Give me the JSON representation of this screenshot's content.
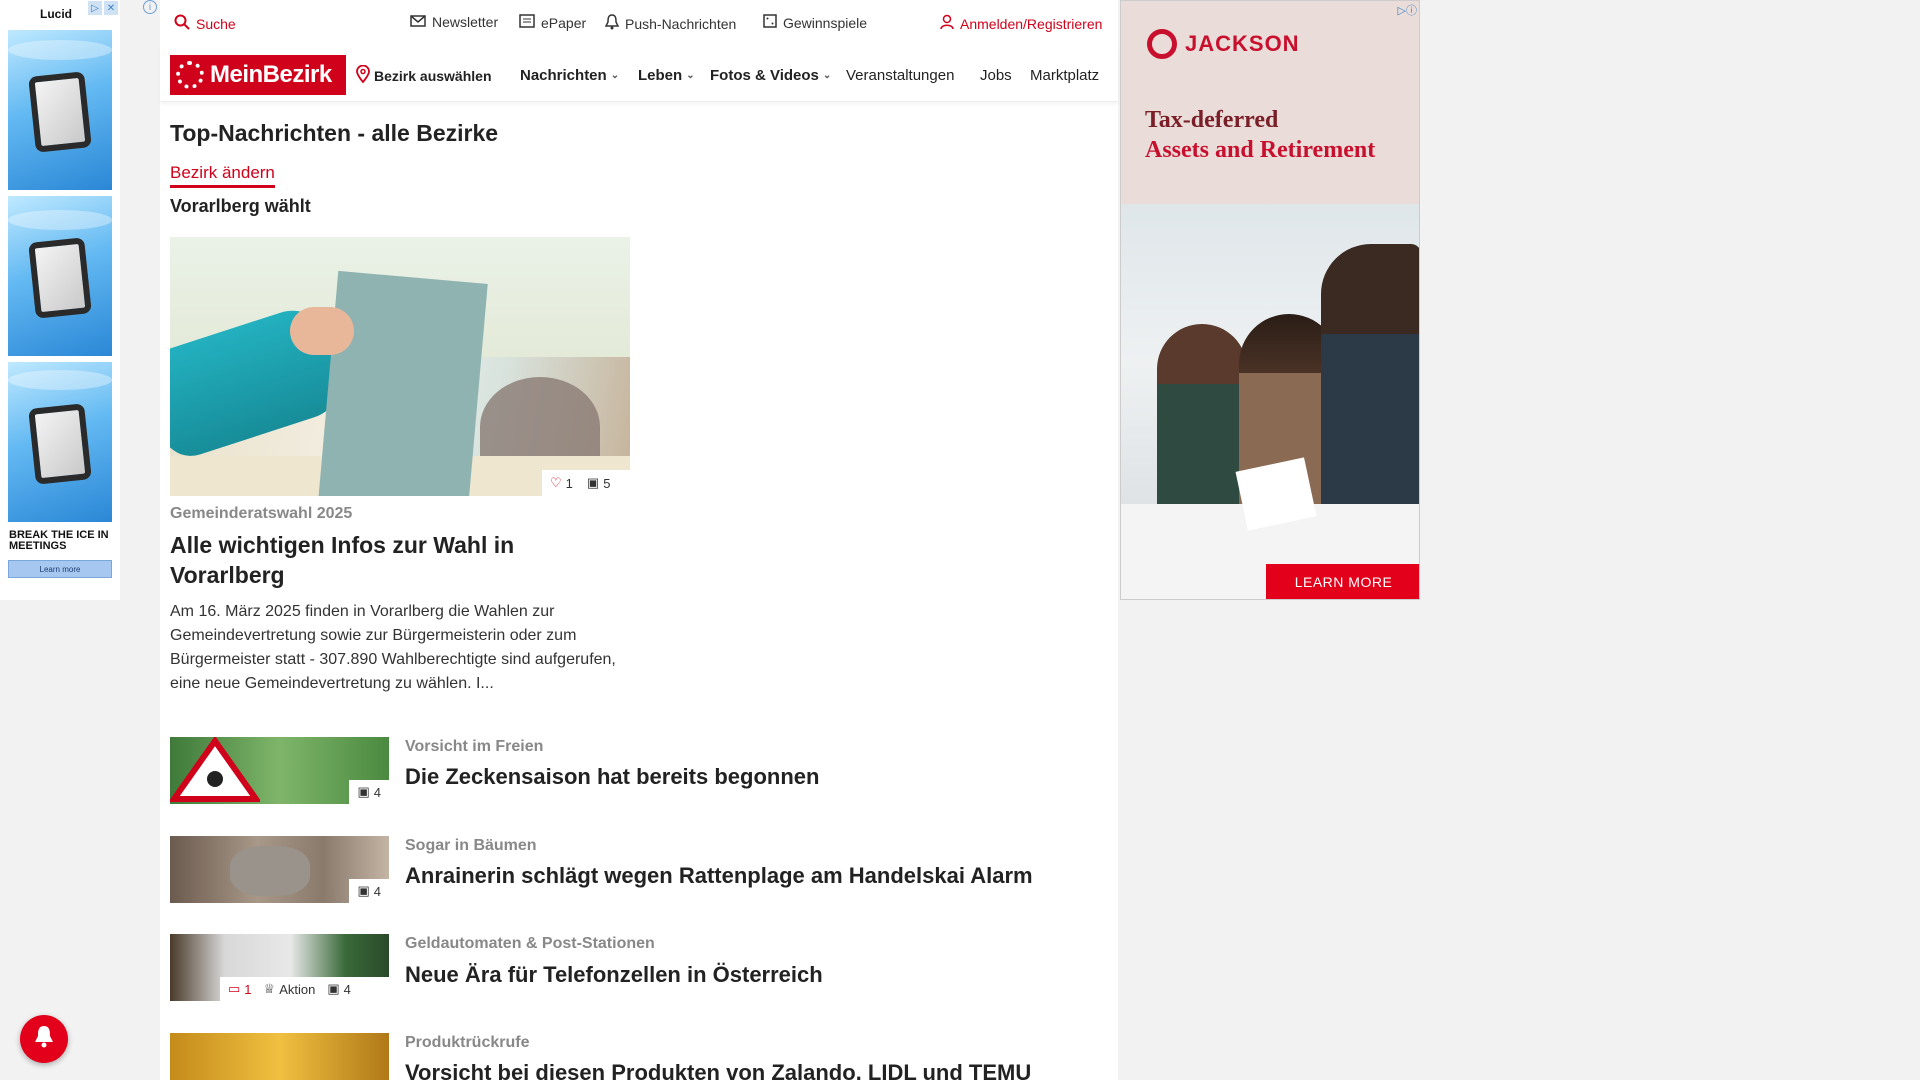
{
  "left_ad": {
    "brand": "Lucid",
    "tagline": "BREAK THE ICE IN MEETINGS",
    "cta": "Learn more"
  },
  "topbar": {
    "search": "Suche",
    "newsletter": "Newsletter",
    "epaper": "ePaper",
    "push": "Push-Nachrichten",
    "gewinnspiele": "Gewinnspiele",
    "login": "Anmelden/Registrieren"
  },
  "nav": {
    "logo": "MeinBezirk",
    "select_district": "Bezirk auswählen",
    "items": [
      "Nachrichten",
      "Leben",
      "Fotos & Videos",
      "Veranstaltungen",
      "Jobs",
      "Marktplatz"
    ]
  },
  "page": {
    "title": "Top-Nachrichten - alle Bezirke",
    "change_link": "Bezirk ändern",
    "section": "Vorarlberg wählt"
  },
  "lead": {
    "likes": "1",
    "photos": "5",
    "kicker": "Gemeinderatswahl 2025",
    "title": "Alle wichtigen Infos zur Wahl in Vorarlberg",
    "teaser": "Am 16. März 2025 finden in Vorarlberg die Wahlen zur Gemeindevertretung sowie zur Bürgermeisterin oder zum Bürgermeister statt - 307.890 Wahlberechtigte sind aufgerufen, eine neue Gemeindevertretung zu wählen. I..."
  },
  "articles": [
    {
      "kicker": "Vorsicht im Freien",
      "title": "Die Zeckensaison hat bereits begonnen",
      "photos": "4"
    },
    {
      "kicker": "Sogar in Bäumen",
      "title": "Anrainerin schlägt wegen Rattenplage am Handelskai Alarm",
      "photos": "4"
    },
    {
      "kicker": "Geldautomaten & Post-Stationen",
      "title": "Neue Ära für Telefonzellen in Österreich",
      "comments": "1",
      "aktion": "Aktion",
      "photos": "4"
    },
    {
      "kicker": "Produktrückrufe",
      "title": "Vorsicht bei diesen Produkten von Zalando, LIDL und TEMU"
    }
  ],
  "right_ad": {
    "brand": "JACKSON",
    "headline_1": "Tax-deferred",
    "headline_2": "Assets and Retirement",
    "cta": "LEARN MORE"
  },
  "colors": {
    "accent": "#d0021b",
    "ad_red": "#e3001b"
  }
}
